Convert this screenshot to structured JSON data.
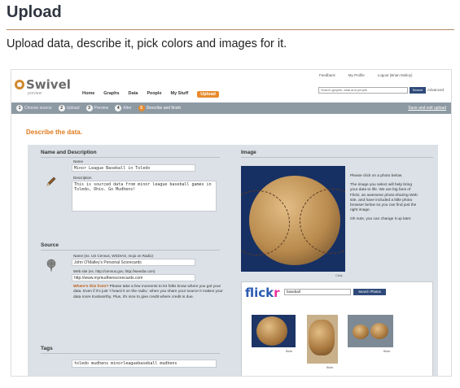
{
  "page": {
    "heading": "Upload",
    "subtitle": "Upload data, describe it, pick colors and images for it."
  },
  "app": {
    "logo_text": "Swivel",
    "logo_tagline": "preview",
    "top_links": [
      "Feedback",
      "My Profile",
      "Logout (Brian Molloy)"
    ],
    "nav": [
      "Home",
      "Graphs",
      "Data",
      "People",
      "My Stuff",
      "Upload"
    ],
    "nav_active_index": 5,
    "search_placeholder": "Search graphs, data and people",
    "search_button": "Search",
    "advanced_link": "Advanced"
  },
  "steps": {
    "items": [
      {
        "num": "1",
        "label": "Choose source"
      },
      {
        "num": "2",
        "label": "Upload"
      },
      {
        "num": "3",
        "label": "Preview"
      },
      {
        "num": "4",
        "label": "Alter"
      },
      {
        "num": "5",
        "label": "Describe and finish"
      }
    ],
    "current_index": 4,
    "save_exit": "Save and exit upload"
  },
  "form": {
    "describe_title": "Describe the data.",
    "name_section": {
      "title": "Name and Description",
      "name_label": "Name",
      "name_value": "Minor League Baseball in Toledo",
      "description_label": "Description",
      "description_value": "This is sourced data from minor league baseball games in Toledo, Ohio.  Go Mudhens!"
    },
    "source_section": {
      "title": "Source",
      "name_label": "Name (ex. US Census, WSDIAS, mojo on Radio)",
      "name_value": "John O'Malley's Personal Scorecards",
      "website_label": "Web site (ex. http://census.gov, http://weedia.com)",
      "website_value": "http://www.mymudhenscorecards.com",
      "note_q": "Where's this from?",
      "note_text": " Please take a few moments to let folks know where you got your data. Even if it's just 'I heard it on the radio,' when you share your source it makes your data more trustworthy. Plus, it's nice to give credit where credit is due."
    },
    "tags_section": {
      "title": "Tags",
      "value": "toledo mudhens minorleaguebaseball mudhens"
    },
    "image_section": {
      "title": "Image",
      "click_label": "Click",
      "help_1": "Please click on a photo below.",
      "help_2": "The image you select will help bring your data to life. We are big fans of Flickr, an awesome photo-sharing Web site, and have included a little photo browser below so you can find just the right image.",
      "help_3": "Oh nuts, you can change it up later.",
      "flickr_logo_a": "flick",
      "flickr_logo_b": "r",
      "flickr_search_value": "baseball",
      "flickr_search_button": "Search Photos",
      "thumb_labels": [
        "flickr",
        "flickr",
        "flickr"
      ]
    }
  }
}
